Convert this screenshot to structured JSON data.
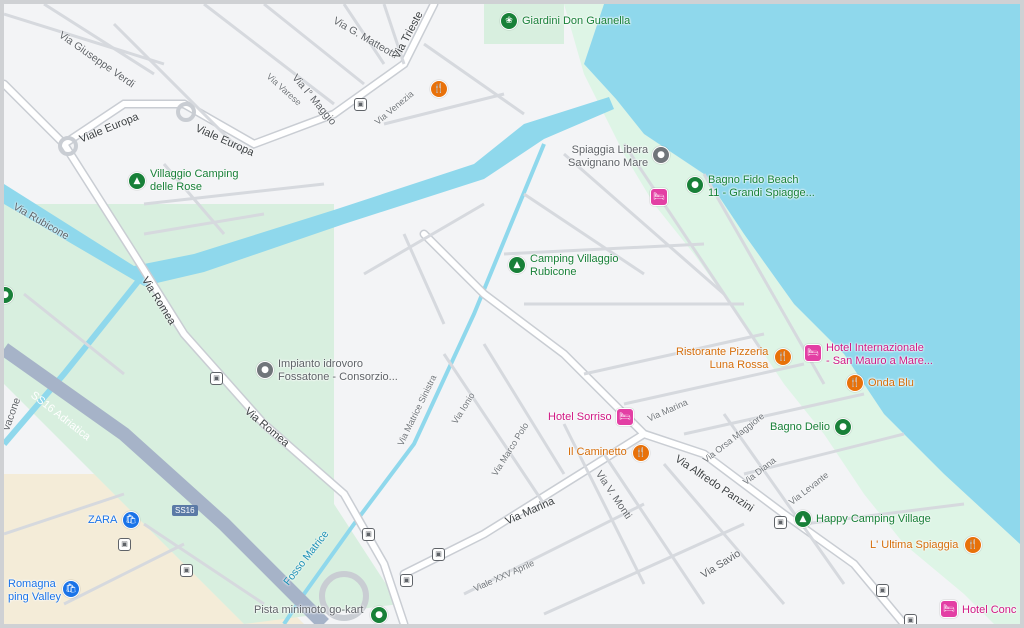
{
  "map": {
    "colors": {
      "water": "#8fd8ec",
      "park": "#ccebd6",
      "land": "#f3f4f6",
      "beach": "#def5e6",
      "urban": "#f4ecd8",
      "road": "#ffffff",
      "roadEdge": "#c9cdd3",
      "highway": "#a6b3c8"
    }
  },
  "streets": {
    "giuseppe_verdi": "Via Giuseppe Verdi",
    "g_matteotti": "Via G. Matteotti",
    "trieste": "Via Trieste",
    "primo_maggio": "Via I° Maggio",
    "varese": "Via Varese",
    "venezia": "Via Venezia",
    "viale_europa_1": "Viale Europa",
    "viale_europa_2": "Viale Europa",
    "rubicone": "Via Rubicone",
    "romea_1": "Via Romea",
    "romea_2": "Via Romea",
    "ss16": "SS16 Adriatica",
    "ss16_badge": "SS16",
    "fosso": "Fosso Matrice",
    "matrice_sinistra": "Via Matrice Sinistra",
    "ionio": "Via Ionio",
    "marco_polo": "Via Marco Polo",
    "marina_1": "Via Marina",
    "marina_2": "Via Marina",
    "v_monti": "Via V. Monti",
    "xxv_aprile": "Viale XXV Aprile",
    "alfredo_panzini": "Via Alfredo Panzini",
    "orsa_maggiore": "Via Orsa Maggiore",
    "diana": "Via Diana",
    "levante": "Via Levante",
    "savio": "Via Savio",
    "vacone": "vacone"
  },
  "places": {
    "giardini": "Giardini Don Guanella",
    "villaggio_rose": [
      "Villaggio Camping",
      "delle Rose"
    ],
    "spiaggia_libera": [
      "Spiaggia Libera",
      "Savignano Mare"
    ],
    "bagno_fido": [
      "Bagno Fido Beach",
      "11 - Grandi Spiagge..."
    ],
    "camping_rubicone": [
      "Camping Villaggio",
      "Rubicone"
    ],
    "impianto": [
      "Impianto idrovoro",
      "Fossatone - Consorzio..."
    ],
    "ristorante_luna": [
      "Ristorante Pizzeria",
      "Luna Rossa"
    ],
    "hotel_internazionale": [
      "Hotel Internazionale",
      "- San Mauro a Mare..."
    ],
    "onda_blu": "Onda Blu",
    "hotel_sorriso": "Hotel Sorriso",
    "bagno_delio": "Bagno Delio",
    "il_caminetto": "Il Caminetto",
    "happy_camping": "Happy Camping Village",
    "ultima_spiaggia": "L' Ultima Spiaggia",
    "hotel_conc": "Hotel Conc",
    "zara": "ZARA",
    "romagna": [
      "Romagna",
      "ping Valley"
    ],
    "pista": "Pista minimoto go-kart"
  },
  "icons": {
    "park": "❀",
    "camping": "▲",
    "restaurant": "🍴",
    "hotel": "🛏",
    "beach": "●",
    "shop": "🛍",
    "bus": "▣",
    "generic": "●"
  }
}
